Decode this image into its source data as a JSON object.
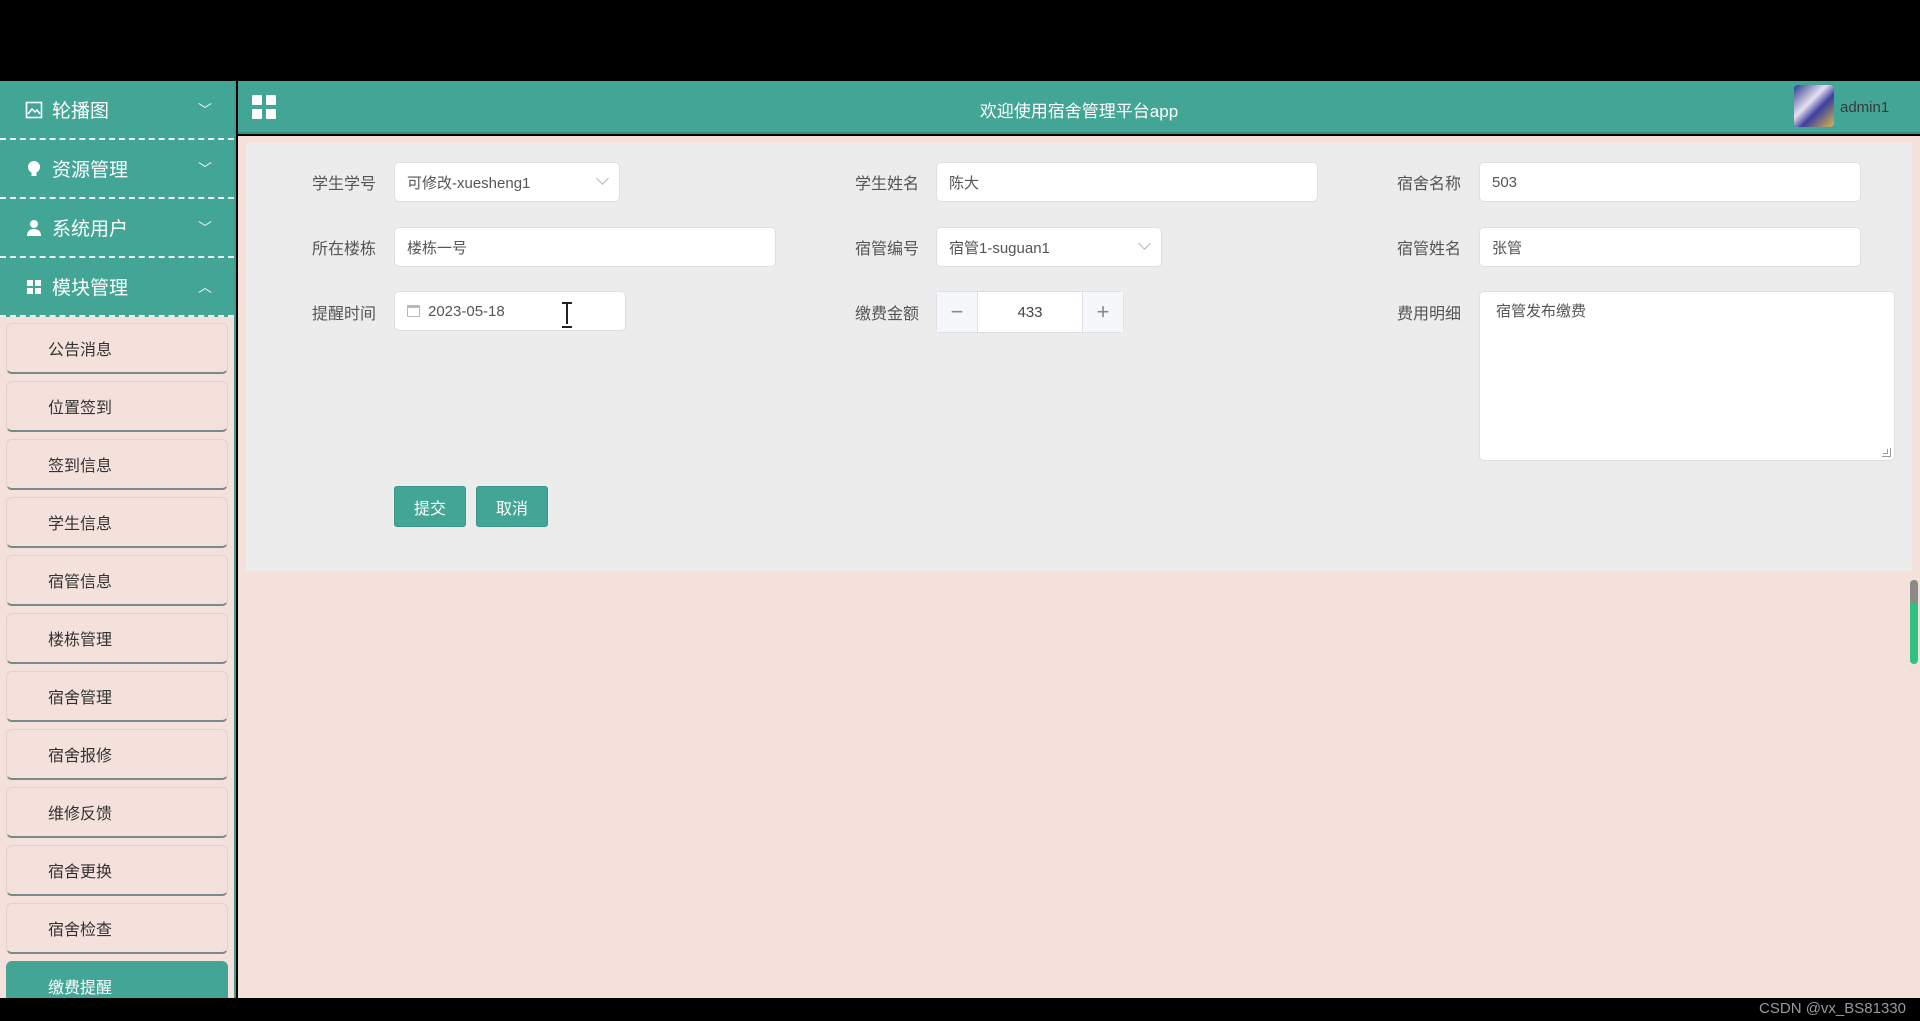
{
  "app": {
    "title": "欢迎使用宿舍管理平台app",
    "user": "admin1"
  },
  "sidebar": {
    "groups": [
      {
        "label": "轮播图",
        "icon": "picture-icon"
      },
      {
        "label": "资源管理",
        "icon": "bulb-icon"
      },
      {
        "label": "系统用户",
        "icon": "user-icon"
      },
      {
        "label": "模块管理",
        "icon": "grid-icon"
      }
    ],
    "items": [
      {
        "label": "公告消息"
      },
      {
        "label": "位置签到"
      },
      {
        "label": "签到信息"
      },
      {
        "label": "学生信息"
      },
      {
        "label": "宿管信息"
      },
      {
        "label": "楼栋管理"
      },
      {
        "label": "宿舍管理"
      },
      {
        "label": "宿舍报修"
      },
      {
        "label": "维修反馈"
      },
      {
        "label": "宿舍更换"
      },
      {
        "label": "宿舍检查"
      },
      {
        "label": "缴费提醒"
      }
    ],
    "active_item": "缴费提醒"
  },
  "form": {
    "student_no": {
      "label": "学生学号",
      "value": "可修改-xuesheng1"
    },
    "student_name": {
      "label": "学生姓名",
      "value": "陈大"
    },
    "dorm_name": {
      "label": "宿舍名称",
      "value": "503"
    },
    "building": {
      "label": "所在楼栋",
      "value": "楼栋一号"
    },
    "manager_no": {
      "label": "宿管编号",
      "value": "宿管1-suguan1"
    },
    "manager_name": {
      "label": "宿管姓名",
      "value": "张管"
    },
    "remind_time": {
      "label": "提醒时间",
      "value": "2023-05-18"
    },
    "amount": {
      "label": "缴费金额",
      "value": "433",
      "minus": "−",
      "plus": "+"
    },
    "fee_detail": {
      "label": "费用明细",
      "value": "宿管发布缴费"
    },
    "submit_label": "提交",
    "cancel_label": "取消"
  },
  "watermark": "CSDN @vx_BS81330",
  "colors": {
    "accent": "#43a596",
    "content_bg": "#f5e1dc",
    "panel_bg": "#ececec"
  }
}
